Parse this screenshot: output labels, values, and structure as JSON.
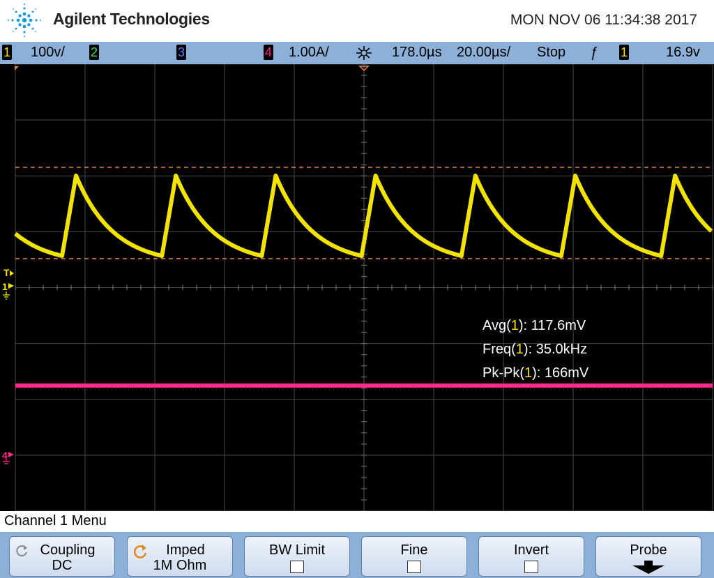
{
  "header": {
    "brand": "Agilent Technologies",
    "datetime": "MON NOV 06 11:34:38 2017"
  },
  "statusbar": {
    "ch1_num": "1",
    "ch1_scale": "100v/",
    "ch2_num": "2",
    "ch3_num": "3",
    "ch4_num": "4",
    "ch4_scale": "1.00A/",
    "time_delay": "178.0µs",
    "time_scale": "20.00µs/",
    "run_state": "Stop",
    "trigger_edge": "ƒ",
    "trigger_ch": "1",
    "trigger_level": "16.9v"
  },
  "markers": {
    "trigger": "T",
    "ch1_ground": "1",
    "ch4_ground": "4"
  },
  "measurements": {
    "avg_label": "Avg(",
    "avg_ch": "1",
    "avg_tail": "): 117.6mV",
    "freq_label": "Freq(",
    "freq_ch": "1",
    "freq_tail": "): 35.0kHz",
    "pkpk_label": "Pk-Pk(",
    "pkpk_ch": "1",
    "pkpk_tail": "): 166mV"
  },
  "menu": {
    "title": "Channel 1  Menu",
    "coupling_label": "Coupling",
    "coupling_value": "DC",
    "imped_label": "Imped",
    "imped_value": "1M Ohm",
    "bwlimit_label": "BW Limit",
    "fine_label": "Fine",
    "invert_label": "Invert",
    "probe_label": "Probe"
  },
  "colors": {
    "ch1": "#f2e300",
    "ch2": "#3fe04a",
    "ch3": "#5a7dff",
    "ch4": "#ff2a8a",
    "cursor": "#e8824a",
    "bar": "#8cb0d8"
  }
}
